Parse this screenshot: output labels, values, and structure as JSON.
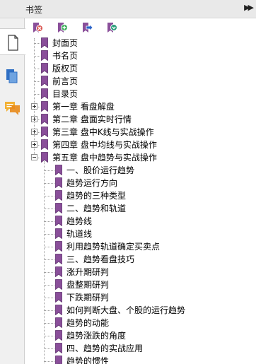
{
  "panel": {
    "title": "书签",
    "expand_glyph": "▶▶"
  },
  "leftbar": {
    "items": [
      {
        "icon": "page-icon",
        "active": true
      },
      {
        "icon": "copy-pages-icon",
        "active": false
      },
      {
        "icon": "comment-icon",
        "active": false
      }
    ]
  },
  "toolbar": {
    "buttons": [
      {
        "icon": "delete-bookmark-icon",
        "color": "#d9534f"
      },
      {
        "icon": "add-bookmark-icon",
        "color": "#3cae5a"
      },
      {
        "icon": "move-bookmark-icon",
        "color": "#2a64c8"
      },
      {
        "icon": "expand-bookmark-icon",
        "color": "#2a9d7a"
      }
    ]
  },
  "colors": {
    "bookmark": "#8a4f9a",
    "bookmark_dark": "#5e2f6e"
  },
  "tree": [
    {
      "label": "封面页",
      "level": 0,
      "expander": "none"
    },
    {
      "label": "书名页",
      "level": 0,
      "expander": "none"
    },
    {
      "label": "版权页",
      "level": 0,
      "expander": "none"
    },
    {
      "label": "前言页",
      "level": 0,
      "expander": "none"
    },
    {
      "label": "目录页",
      "level": 0,
      "expander": "none"
    },
    {
      "label": "第一章 看盘解盘",
      "level": 0,
      "expander": "plus"
    },
    {
      "label": "第二章 盘面实时行情",
      "level": 0,
      "expander": "plus"
    },
    {
      "label": "第三章 盘中K线与实战操作",
      "level": 0,
      "expander": "plus"
    },
    {
      "label": "第四章 盘中均线与实战操作",
      "level": 0,
      "expander": "plus"
    },
    {
      "label": "第五章 盘中趋势与实战操作",
      "level": 0,
      "expander": "minus"
    },
    {
      "label": "一、股价运行趋势",
      "level": 1,
      "expander": "none"
    },
    {
      "label": "趋势运行方向",
      "level": 1,
      "expander": "none"
    },
    {
      "label": "趋势的三种类型",
      "level": 1,
      "expander": "none"
    },
    {
      "label": "二、趋势和轨道",
      "level": 1,
      "expander": "none"
    },
    {
      "label": "趋势线",
      "level": 1,
      "expander": "none"
    },
    {
      "label": "轨道线",
      "level": 1,
      "expander": "none"
    },
    {
      "label": "利用趋势轨道确定买卖点",
      "level": 1,
      "expander": "none"
    },
    {
      "label": "三、趋势看盘技巧",
      "level": 1,
      "expander": "none"
    },
    {
      "label": "涨升期研判",
      "level": 1,
      "expander": "none"
    },
    {
      "label": "盘整期研判",
      "level": 1,
      "expander": "none"
    },
    {
      "label": "下跌期研判",
      "level": 1,
      "expander": "none"
    },
    {
      "label": "如何判断大盘、个股的运行趋势",
      "level": 1,
      "expander": "none"
    },
    {
      "label": "趋势的动能",
      "level": 1,
      "expander": "none"
    },
    {
      "label": "趋势涨跌的角度",
      "level": 1,
      "expander": "none"
    },
    {
      "label": "四、趋势的实战应用",
      "level": 1,
      "expander": "none"
    },
    {
      "label": "趋势的惯性",
      "level": 1,
      "expander": "none"
    }
  ]
}
